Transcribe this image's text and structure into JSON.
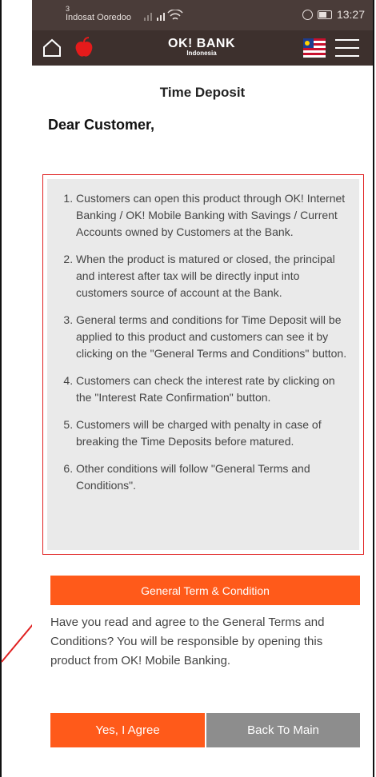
{
  "statusbar": {
    "sim_slot": "3",
    "carrier": "Indosat Ooredoo",
    "time": "13:27"
  },
  "navbar": {
    "brand": "OK! BANK",
    "brand_sub": "Indonesia"
  },
  "page": {
    "title": "Time Deposit",
    "greeting": "Dear Customer,"
  },
  "terms": [
    "Customers can open this product through OK! Internet Banking / OK! Mobile Banking with Savings / Current Accounts owned by Customers at the Bank.",
    "When the product is matured or closed, the principal and interest after tax will be directly input into customers source of account at the Bank.",
    "General terms and conditions for Time Deposit will be applied to this product and customers can see it by clicking on the \"General Terms and Conditions\" button.",
    "Customers can check the interest rate by clicking on the \"Interest Rate Confirmation\" button.",
    "Customers will be charged with penalty in case of breaking the Time Deposits before matured.",
    "Other conditions will follow \"General Terms and Conditions\"."
  ],
  "buttons": {
    "general_terms": "General Term & Condition",
    "agree": "Yes, I Agree",
    "back": "Back To Main"
  },
  "agreement_question": "Have you read and agree to the General Terms and Conditions? You will be responsible by opening this product from OK! Mobile Banking.",
  "colors": {
    "accent": "#ff5a1a",
    "header": "#3d302d",
    "highlight_border": "#e02020",
    "secondary_button": "#8d8d8d"
  }
}
